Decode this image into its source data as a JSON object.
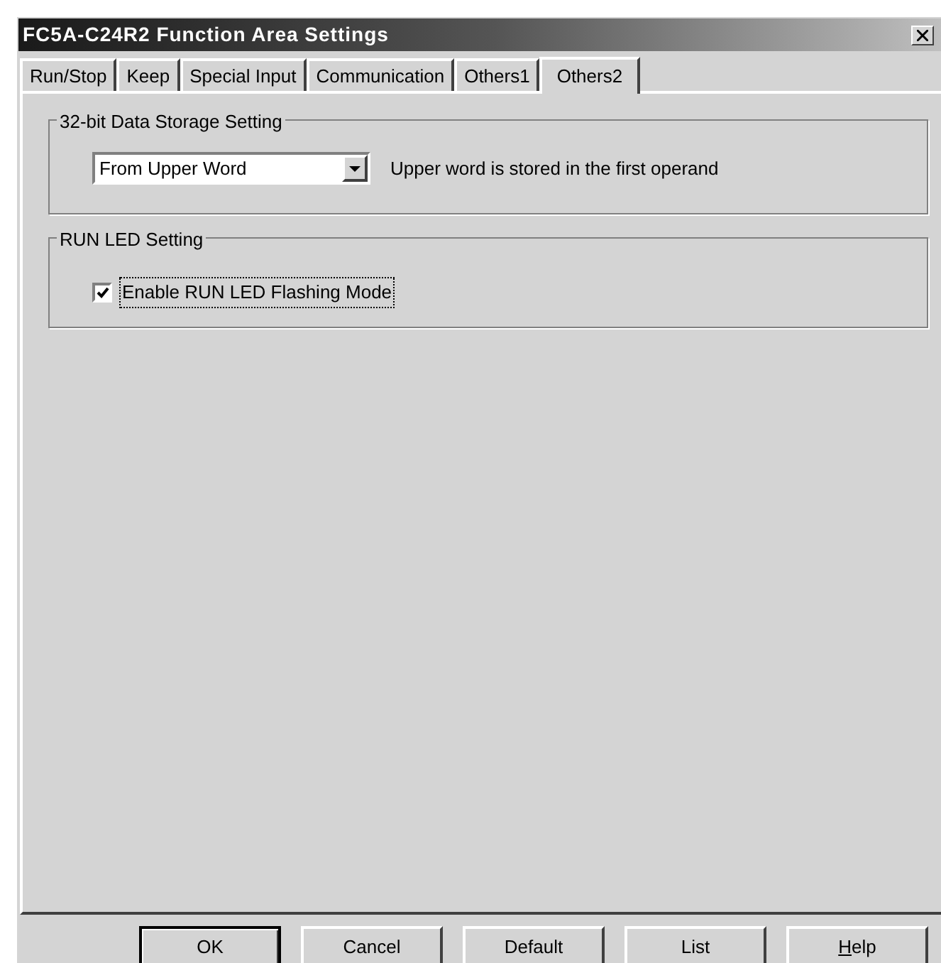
{
  "window": {
    "title": "FC5A-C24R2 Function Area Settings"
  },
  "tabs": [
    {
      "label": "Run/Stop",
      "selected": false
    },
    {
      "label": "Keep",
      "selected": false
    },
    {
      "label": "Special Input",
      "selected": false
    },
    {
      "label": "Communication",
      "selected": false
    },
    {
      "label": "Others1",
      "selected": false
    },
    {
      "label": "Others2",
      "selected": true
    }
  ],
  "storage_group": {
    "title": "32-bit Data Storage Setting",
    "dropdown": {
      "value": "From Upper Word"
    },
    "description": "Upper word is stored in the first operand"
  },
  "led_group": {
    "title": "RUN LED Setting",
    "checkbox": {
      "label": "Enable RUN LED Flashing Mode",
      "checked": true
    }
  },
  "buttons": [
    {
      "label": "OK",
      "default": true
    },
    {
      "label": "Cancel",
      "default": false
    },
    {
      "label": "Default",
      "default": false
    },
    {
      "label": "List",
      "default": false
    },
    {
      "label": "Help",
      "default": false,
      "mnemonic": true
    }
  ]
}
